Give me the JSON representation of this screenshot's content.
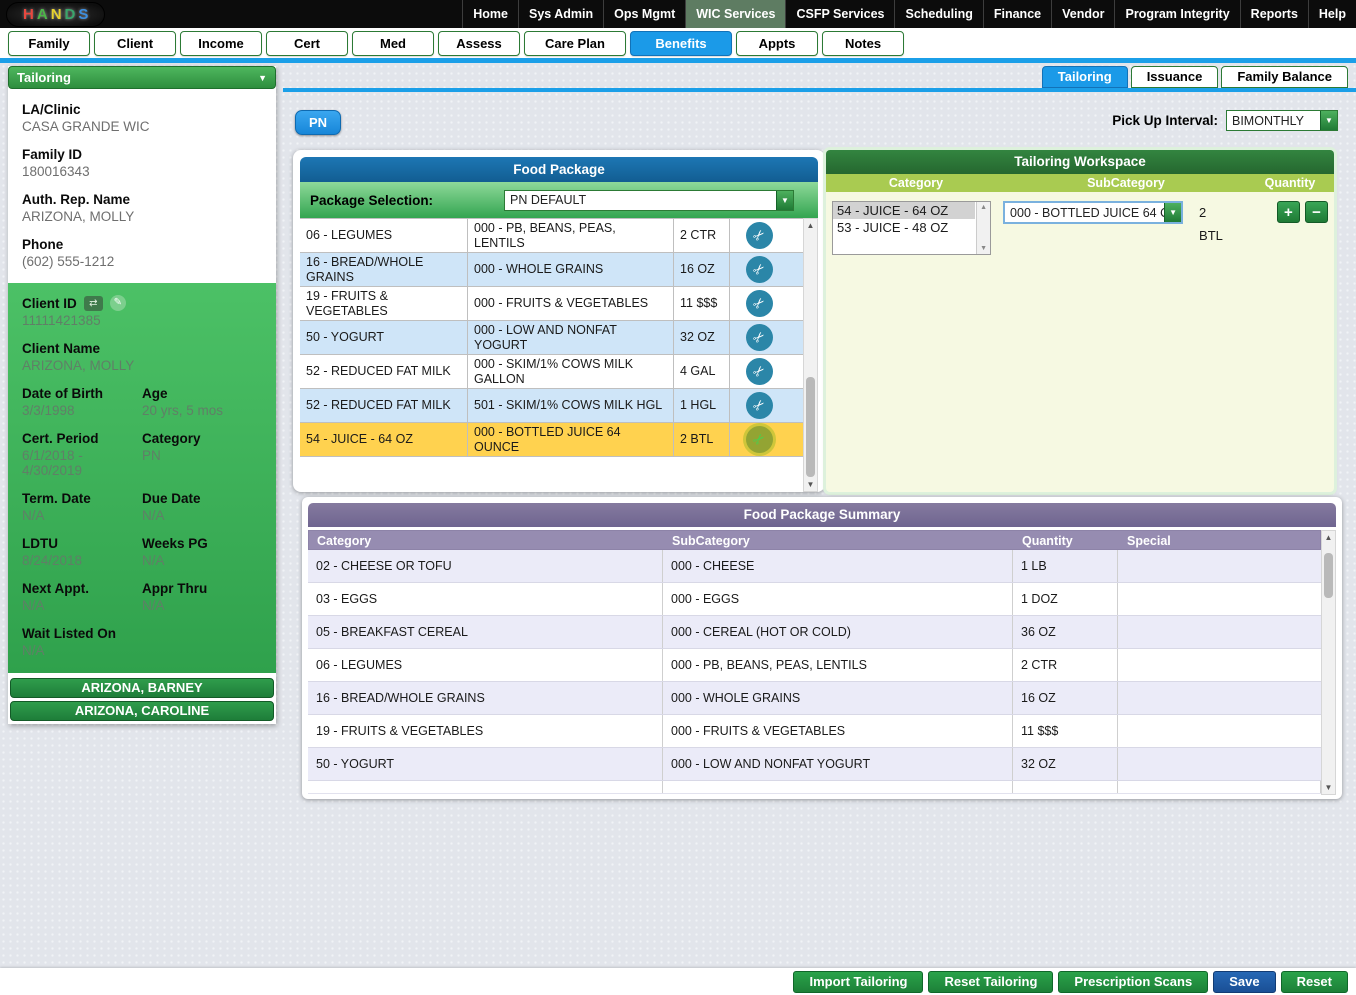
{
  "icons": {
    "chevron_down": "▼",
    "arrow_up": "▲",
    "arrow_down": "▼",
    "scissors": "✂",
    "swap": "⇄",
    "edit": "✎",
    "plus": "+",
    "minus": "−"
  },
  "app": {
    "logo_letters": [
      {
        "ch": "H",
        "color": "#e8483f"
      },
      {
        "ch": "A",
        "color": "#4cb648"
      },
      {
        "ch": "N",
        "color": "#e8d22f"
      },
      {
        "ch": "D",
        "color": "#3aa56b"
      },
      {
        "ch": "S",
        "color": "#3d8fe0"
      }
    ],
    "nav": [
      "Home",
      "Sys Admin",
      "Ops Mgmt",
      "WIC Services",
      "CSFP Services",
      "Scheduling",
      "Finance",
      "Vendor",
      "Program Integrity",
      "Reports",
      "Help"
    ],
    "nav_active": "WIC Services"
  },
  "tabs": {
    "items": [
      "Family",
      "Client",
      "Income",
      "Cert",
      "Med",
      "Assess",
      "Care Plan",
      "Benefits",
      "Appts",
      "Notes"
    ],
    "active": "Benefits"
  },
  "subtabs": {
    "items": [
      "Tailoring",
      "Issuance",
      "Family Balance"
    ],
    "active": "Tailoring"
  },
  "sidebar": {
    "header": "Tailoring",
    "top_fields": [
      {
        "label": "LA/Clinic",
        "value": "CASA GRANDE WIC"
      },
      {
        "label": "Family ID",
        "value": "180016343"
      },
      {
        "label": "Auth. Rep. Name",
        "value": "ARIZONA, MOLLY"
      },
      {
        "label": "Phone",
        "value": "(602) 555-1212"
      }
    ],
    "client": {
      "client_id_label": "Client ID",
      "client_id": "11111421385",
      "client_name_label": "Client Name",
      "client_name": "ARIZONA, MOLLY",
      "pairs": [
        [
          {
            "label": "Date of Birth",
            "value": "3/3/1998"
          },
          {
            "label": "Age",
            "value": "20 yrs, 5 mos"
          }
        ],
        [
          {
            "label": "Cert. Period",
            "value": "6/1/2018 - 4/30/2019"
          },
          {
            "label": "Category",
            "value": "PN"
          }
        ],
        [
          {
            "label": "Term. Date",
            "value": "N/A"
          },
          {
            "label": "Due Date",
            "value": "N/A"
          }
        ],
        [
          {
            "label": "LDTU",
            "value": "8/24/2018"
          },
          {
            "label": "Weeks PG",
            "value": "N/A"
          }
        ],
        [
          {
            "label": "Next Appt.",
            "value": "N/A"
          },
          {
            "label": "Appr Thru",
            "value": "N/A"
          }
        ]
      ],
      "wait_label": "Wait Listed On",
      "wait_value": "N/A"
    },
    "family_members": [
      "ARIZONA, BARNEY",
      "ARIZONA, CAROLINE"
    ]
  },
  "content": {
    "category_tab": "PN",
    "pickup_interval_label": "Pick Up Interval:",
    "pickup_interval_value": "BIMONTHLY",
    "food_package": {
      "title": "Food Package",
      "package_selection_label": "Package Selection:",
      "package_selection_value": "PN DEFAULT",
      "rows": [
        {
          "category": "06 - LEGUMES",
          "subcategory": "000 - PB, BEANS, PEAS, LENTILS",
          "qty": "2 CTR",
          "selected": false
        },
        {
          "category": "16 - BREAD/WHOLE GRAINS",
          "subcategory": "000 - WHOLE GRAINS",
          "qty": "16 OZ",
          "selected": false
        },
        {
          "category": "19 - FRUITS & VEGETABLES",
          "subcategory": "000 - FRUITS & VEGETABLES",
          "qty": "11 $$$",
          "selected": false
        },
        {
          "category": "50 - YOGURT",
          "subcategory": "000 - LOW AND NONFAT YOGURT",
          "qty": "32 OZ",
          "selected": false
        },
        {
          "category": "52 - REDUCED FAT MILK",
          "subcategory": "000 - SKIM/1% COWS MILK GALLON",
          "qty": "4 GAL",
          "selected": false
        },
        {
          "category": "52 - REDUCED FAT MILK",
          "subcategory": "501 - SKIM/1% COWS MILK HGL",
          "qty": "1 HGL",
          "selected": false
        },
        {
          "category": "54 - JUICE - 64 OZ",
          "subcategory": "000 - BOTTLED JUICE 64 OUNCE",
          "qty": "2 BTL",
          "selected": true
        }
      ]
    },
    "workspace": {
      "title": "Tailoring Workspace",
      "columns": [
        "Category",
        "SubCategory",
        "Quantity"
      ],
      "category_options": [
        "54 - JUICE - 64 OZ",
        "53 - JUICE - 48 OZ"
      ],
      "selected_category": "54 - JUICE - 64 OZ",
      "subcategory_value": "000 - BOTTLED JUICE 64 O",
      "quantity": "2 BTL"
    },
    "summary": {
      "title": "Food Package Summary",
      "columns": [
        "Category",
        "SubCategory",
        "Quantity",
        "Special"
      ],
      "rows": [
        {
          "category": "02 - CHEESE OR TOFU",
          "subcategory": "000 - CHEESE",
          "qty": "1 LB",
          "special": ""
        },
        {
          "category": "03 - EGGS",
          "subcategory": "000 - EGGS",
          "qty": "1 DOZ",
          "special": ""
        },
        {
          "category": "05 - BREAKFAST CEREAL",
          "subcategory": "000 - CEREAL (HOT OR COLD)",
          "qty": "36 OZ",
          "special": ""
        },
        {
          "category": "06 - LEGUMES",
          "subcategory": "000 - PB, BEANS, PEAS, LENTILS",
          "qty": "2 CTR",
          "special": ""
        },
        {
          "category": "16 - BREAD/WHOLE GRAINS",
          "subcategory": "000 - WHOLE GRAINS",
          "qty": "16 OZ",
          "special": ""
        },
        {
          "category": "19 - FRUITS & VEGETABLES",
          "subcategory": "000 - FRUITS & VEGETABLES",
          "qty": "11 $$$",
          "special": ""
        },
        {
          "category": "50 - YOGURT",
          "subcategory": "000 - LOW AND NONFAT YOGURT",
          "qty": "32 OZ",
          "special": ""
        }
      ]
    }
  },
  "footer": {
    "buttons": [
      {
        "label": "Import Tailoring",
        "style": "green"
      },
      {
        "label": "Reset Tailoring",
        "style": "green"
      },
      {
        "label": "Prescription Scans",
        "style": "green"
      },
      {
        "label": "Save",
        "style": "blue"
      },
      {
        "label": "Reset",
        "style": "green"
      }
    ]
  }
}
